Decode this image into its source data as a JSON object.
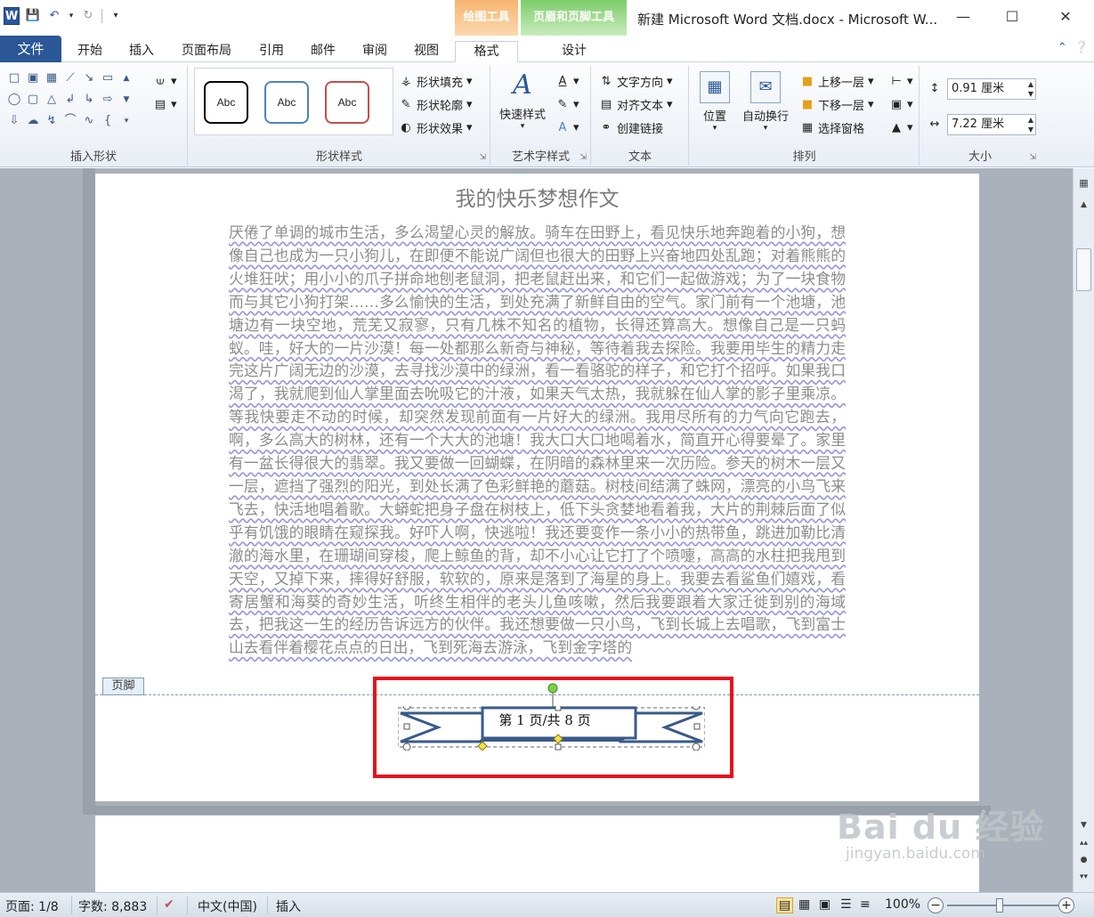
{
  "window": {
    "title": "新建 Microsoft Word 文档.docx - Microsoft W...",
    "contextual_tabs": {
      "drawing_tools": "绘图工具",
      "header_footer_tools": "页眉和页脚工具"
    }
  },
  "tabs": {
    "file": "文件",
    "items": [
      "开始",
      "插入",
      "页面布局",
      "引用",
      "邮件",
      "审阅",
      "视图",
      "格式",
      "设计"
    ]
  },
  "ribbon": {
    "insert_shapes": {
      "label": "插入形状"
    },
    "shape_styles": {
      "label": "形状样式",
      "samples": [
        "Abc",
        "Abc",
        "Abc"
      ],
      "fill": "形状填充",
      "outline": "形状轮廓",
      "effects": "形状效果"
    },
    "wordart": {
      "label": "艺术字样式",
      "quick_styles": "快速样式"
    },
    "text": {
      "label": "文本",
      "direction": "文字方向",
      "align": "对齐文本",
      "link": "创建链接"
    },
    "arrange": {
      "label": "排列",
      "position": "位置",
      "wrap": "自动换行",
      "bring_forward": "上移一层",
      "send_backward": "下移一层",
      "selection_pane": "选择窗格"
    },
    "size": {
      "label": "大小",
      "height": "0.91 厘米",
      "width": "7.22 厘米"
    }
  },
  "document": {
    "heading": "我的快乐梦想作文",
    "body": "厌倦了单调的城市生活，多么渴望心灵的解放。骑车在田野上，看见快乐地奔跑着的小狗，想像自己也成为一只小狗儿，在即便不能说广阔但也很大的田野上兴奋地四处乱跑；对着熊熊的火堆狂吠；用小小的爪子拼命地刨老鼠洞，把老鼠赶出来，和它们一起做游戏；为了一块食物而与其它小狗打架……多么愉快的生活，到处充满了新鲜自由的空气。家门前有一个池塘，池塘边有一块空地，荒芜又寂寥，只有几株不知名的植物，长得还算高大。想像自己是一只蚂蚁。哇，好大的一片沙漠！每一处都那么新奇与神秘，等待着我去探险。我要用毕生的精力走完这片广阔无边的沙漠，去寻找沙漠中的绿洲，看一看骆驼的样子，和它打个招呼。如果我口渴了，我就爬到仙人掌里面去吮吸它的汁液，如果天气太热，我就躲在仙人掌的影子里乘凉。等我快要走不动的时候，却突然发现前面有一片好大的绿洲。我用尽所有的力气向它跑去，啊，多么高大的树林，还有一个大大的池塘！我大口大口地喝着水，简直开心得要晕了。家里有一盆长得很大的翡翠。我又要做一回蝴蝶，在阴暗的森林里来一次历险。参天的树木一层又一层，遮挡了强烈的阳光，到处长满了色彩鲜艳的蘑菇。树枝间结满了蛛网，漂亮的小鸟飞来飞去，快活地唱着歌。大蟒蛇把身子盘在树枝上，低下头贪婪地看着我，大片的荆棘后面了似乎有饥饿的眼睛在窥探我。好吓人啊，快逃啦！我还要变作一条小小的热带鱼，跳进加勒比清澈的海水里，在珊瑚间穿梭，爬上鲸鱼的背，却不小心让它打了个喷嚏，高高的水柱把我甩到天空，又掉下来，摔得好舒服，软软的，原来是落到了海星的身上。我要去看鲨鱼们嬉戏，看寄居蟹和海葵的奇妙生活，听终生相伴的老头儿鱼咳嗽，然后我要跟着大家迁徙到别的海域去，把我这一生的经历告诉远方的伙伴。我还想要做一只小鸟，飞到长城上去唱歌，飞到富士山去看伴着樱花点点的日出，飞到死海去游泳，飞到金字塔的",
    "footer_tag": "页脚",
    "page_number_text": "第 1 页/共 8 页"
  },
  "statusbar": {
    "page": "页面: 1/8",
    "words": "字数: 8,883",
    "language": "中文(中国)",
    "mode": "插入",
    "zoom": "100%"
  },
  "watermark": {
    "main": "Bai du 经验",
    "sub": "jingyan.baidu.com"
  },
  "colors": {
    "file_tab": "#2b5797",
    "highlight_box": "#e8101b",
    "ribbon_shape_stroke": "#3a5a88"
  }
}
